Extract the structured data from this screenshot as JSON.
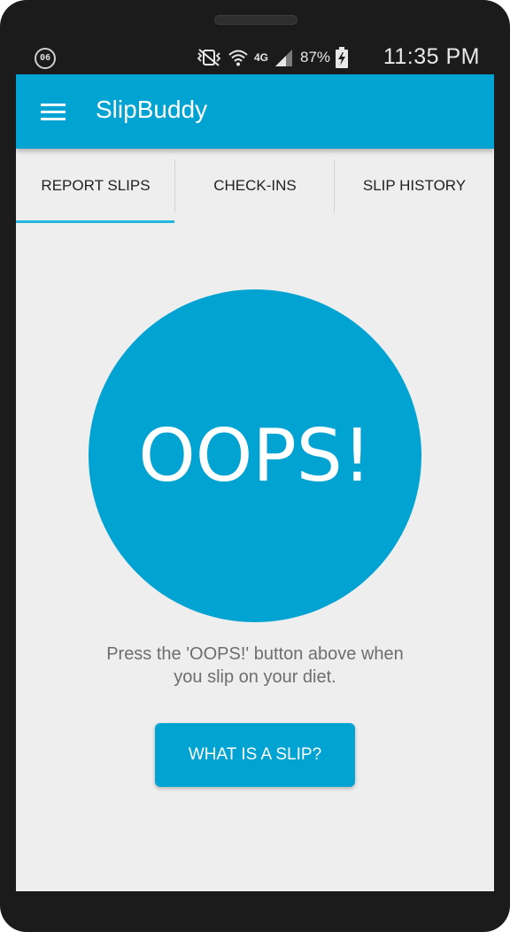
{
  "status_bar": {
    "notification_badge": "06",
    "network": "4G",
    "battery": "87%",
    "time": "11:35 PM",
    "icons": [
      "mute-vibrate-icon",
      "wifi-icon",
      "lte-icon",
      "signal-icon",
      "battery-charging-icon"
    ]
  },
  "app_bar": {
    "title": "SlipBuddy",
    "menu_icon": "hamburger-menu-icon"
  },
  "tabs": [
    {
      "label": "REPORT SLIPS",
      "selected": true
    },
    {
      "label": "CHECK-INS",
      "selected": false
    },
    {
      "label": "SLIP HISTORY",
      "selected": false
    }
  ],
  "main": {
    "oops_label": "OOPS!",
    "hint_line1": "Press the 'OOPS!' button above when",
    "hint_line2": "you slip on your diet.",
    "what_is_slip_label": "WHAT IS A SLIP?"
  },
  "colors": {
    "accent": "#00a3d1",
    "tab_indicator": "#21b5e0",
    "background": "#eeeeee"
  }
}
